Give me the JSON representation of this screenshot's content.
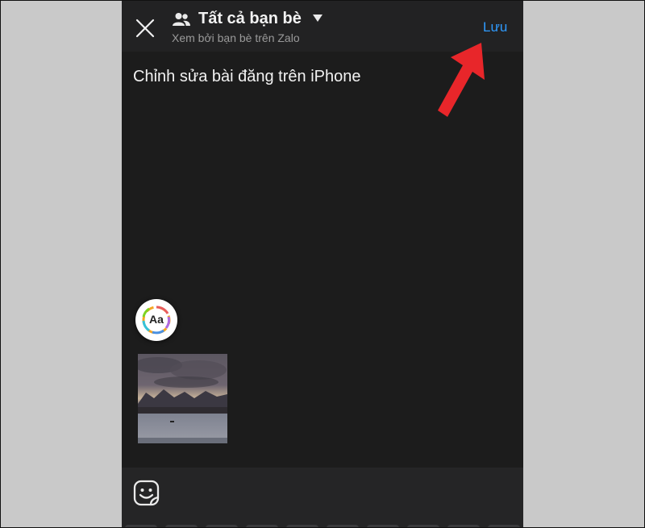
{
  "header": {
    "audience_title": "Tất cả bạn bè",
    "audience_subtitle": "Xem bởi bạn bè trên Zalo",
    "save_label": "Lưu"
  },
  "post": {
    "text": "Chỉnh sửa bài đăng trên iPhone"
  },
  "font_button": {
    "label": "Aa"
  },
  "icons": {
    "close": "close-icon",
    "audience": "friends-icon",
    "dropdown": "caret-down-icon",
    "font_style": "text-style-icon",
    "sticker": "sticker-icon",
    "annotation_arrow": "red-arrow-icon"
  },
  "colors": {
    "accent": "#2f9bff",
    "background": "#1c1c1c",
    "annotation": "#e8262a"
  }
}
